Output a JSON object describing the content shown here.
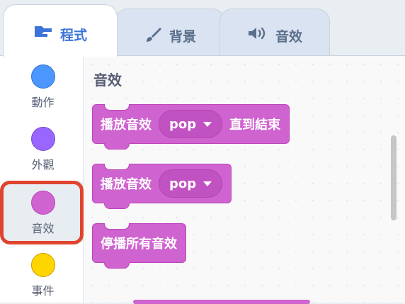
{
  "tabs": [
    {
      "label": "程式",
      "icon": "code-icon"
    },
    {
      "label": "背景",
      "icon": "brush-icon"
    },
    {
      "label": "音效",
      "icon": "speaker-icon"
    }
  ],
  "categories": [
    {
      "label": "動作",
      "color": "#4c97ff"
    },
    {
      "label": "外觀",
      "color": "#9966ff"
    },
    {
      "label": "音效",
      "color": "#cf63cf"
    },
    {
      "label": "事件",
      "color": "#ffd500"
    }
  ],
  "highlight_color": "#e0442f",
  "section_title": "音效",
  "blocks": {
    "play_until_done": {
      "prefix": "播放音效",
      "sound": "pop",
      "suffix": "直到結束"
    },
    "start_sound": {
      "prefix": "播放音效",
      "sound": "pop"
    },
    "stop_all": {
      "label": "停播所有音效"
    }
  },
  "colors": {
    "sound_block": "#cf63cf",
    "active_tab_text": "#3b74d9"
  }
}
